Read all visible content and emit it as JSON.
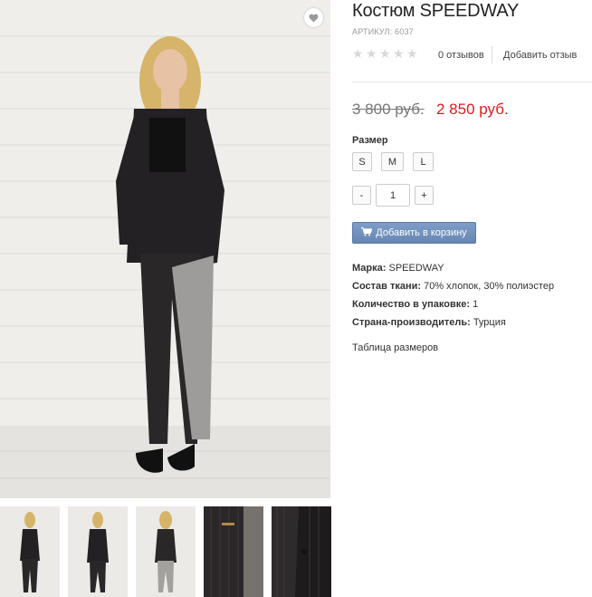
{
  "product": {
    "title": "Костюм SPEEDWAY",
    "sku": "АРТИКУЛ: 6037",
    "reviews": "0 отзывов",
    "add_review": "Добавить отзыв",
    "old_price": "3 800 руб.",
    "new_price": "2 850 руб.",
    "rating_stars": 5,
    "rating_value": 0
  },
  "size": {
    "label": "Размер",
    "options": [
      "S",
      "M",
      "L"
    ]
  },
  "quantity": {
    "minus": "-",
    "value": "1",
    "plus": "+"
  },
  "cart": {
    "label": "Добавить в корзину",
    "icon": "cart-icon"
  },
  "props": [
    {
      "key": "Марка:",
      "value": "SPEEDWAY"
    },
    {
      "key": "Состав ткани:",
      "value": "70% хлопок, 30% полиэстер"
    },
    {
      "key": "Количество в упаковке:",
      "value": "1"
    },
    {
      "key": "Страна-производитель:",
      "value": "Турция"
    }
  ],
  "size_table": "Таблица размеров",
  "icons": {
    "favorite": "heart-icon",
    "star": "star-icon"
  },
  "colors": {
    "price": "#e0191e",
    "cart_button": "#7391bd",
    "star_empty": "#d8d8d8"
  }
}
